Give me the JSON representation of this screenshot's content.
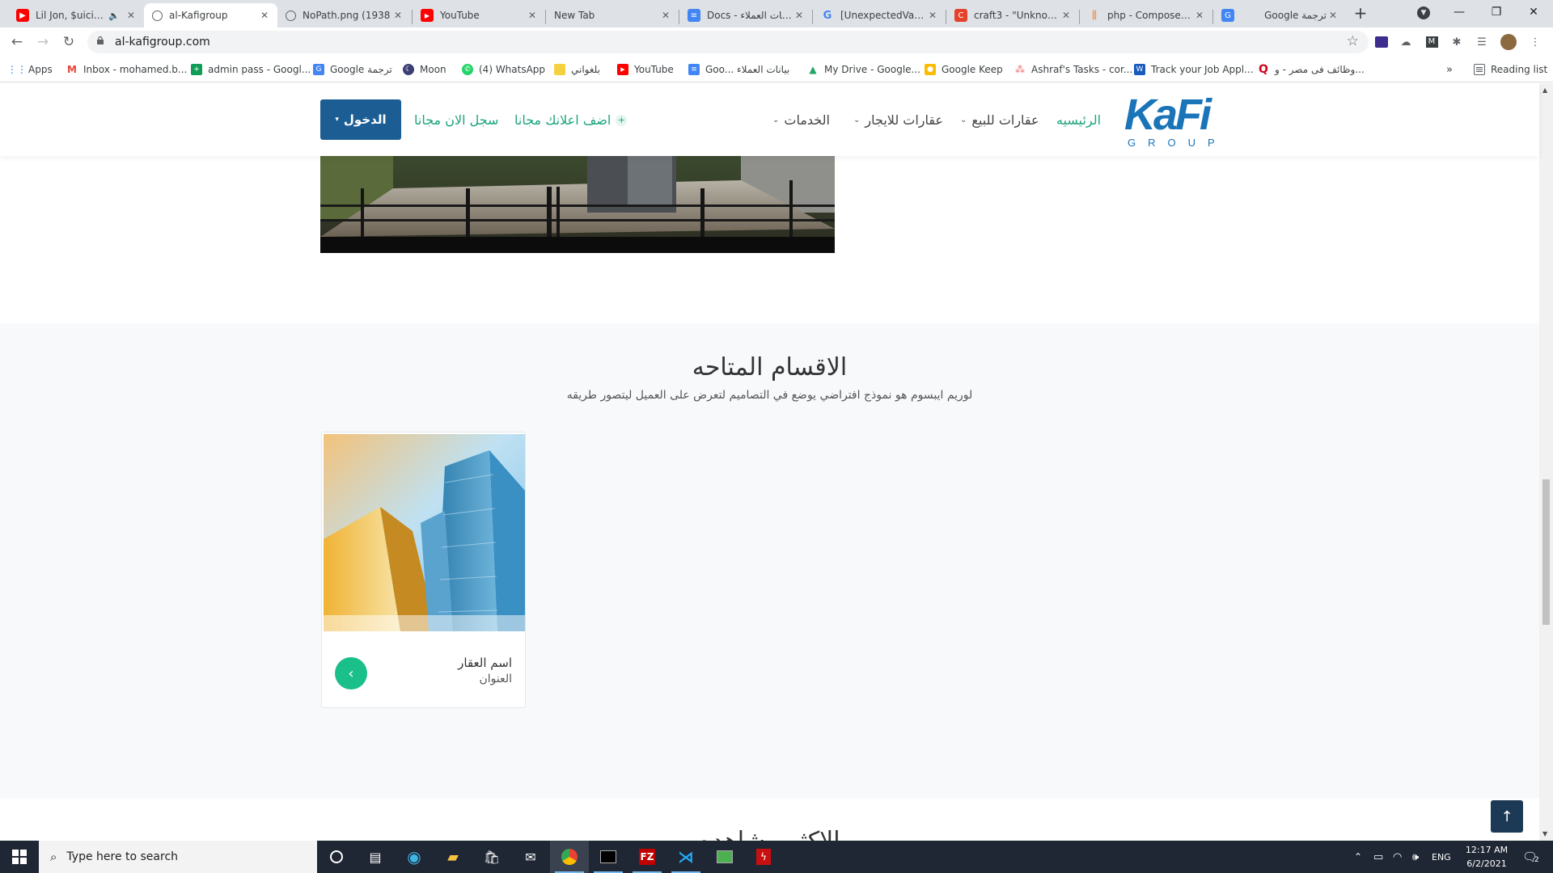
{
  "browser": {
    "tabs": [
      {
        "title": "Lil Jon, $uicide",
        "favicon": "youtube-icon",
        "color": "#ff0000",
        "muted": true
      },
      {
        "title": "al-Kafigroup",
        "favicon": "globe-icon",
        "color": "#5f6368",
        "active": true
      },
      {
        "title": "NoPath.png (1938",
        "favicon": "globe-icon",
        "color": "#5f6368"
      },
      {
        "title": "YouTube",
        "favicon": "youtube-icon",
        "color": "#ff0000"
      },
      {
        "title": "New Tab",
        "favicon": "none",
        "color": ""
      },
      {
        "title": "Docs - بيانات العملاء",
        "favicon": "docs-icon",
        "color": "#4285f4"
      },
      {
        "title": "[UnexpectedValue",
        "favicon": "google-icon",
        "color": "#4285f4"
      },
      {
        "title": "craft3 - \"Unknown",
        "favicon": "craft-icon",
        "color": "#e5422b"
      },
      {
        "title": "php - Composer c",
        "favicon": "stackoverflow-icon",
        "color": "#f48024"
      },
      {
        "title": "Google ترجمة",
        "favicon": "translate-icon",
        "color": "#4285f4"
      }
    ],
    "url": "al-kafigroup.com",
    "bookmarks": [
      {
        "label": "Apps",
        "icon": "apps-grid-icon",
        "color": "#ea4335"
      },
      {
        "label": "Inbox - mohamed.b...",
        "icon": "gmail-icon",
        "color": "#ea4335"
      },
      {
        "label": "admin pass - Googl...",
        "icon": "sheets-plus-icon",
        "color": "#0f9d58"
      },
      {
        "label": "Google ترجمة",
        "icon": "translate-icon",
        "color": "#4285f4"
      },
      {
        "label": "Moon",
        "icon": "moon-icon",
        "color": "#3b3f73"
      },
      {
        "label": "(4) WhatsApp",
        "icon": "whatsapp-icon",
        "color": "#25d366"
      },
      {
        "label": "بلغواني",
        "icon": "note-icon",
        "color": "#f6d13f"
      },
      {
        "label": "YouTube",
        "icon": "youtube-icon",
        "color": "#ff0000"
      },
      {
        "label": "Goo... بيانات العملاء",
        "icon": "docs-icon",
        "color": "#4285f4"
      },
      {
        "label": "My Drive - Google...",
        "icon": "drive-icon",
        "color": "#1fa463"
      },
      {
        "label": "Google Keep",
        "icon": "keep-icon",
        "color": "#fbbc04"
      },
      {
        "label": "Ashraf's Tasks - cor...",
        "icon": "asana-icon",
        "color": "#f06a6a"
      },
      {
        "label": "Track your Job Appl...",
        "icon": "word-icon",
        "color": "#185abd"
      },
      {
        "label": "وظائف فى مصر - و...",
        "icon": "search-q-icon",
        "color": "#d0021b"
      }
    ],
    "reading_list": "Reading list"
  },
  "site": {
    "nav": {
      "home": "الرئيسيه",
      "for_sale": "عقارات للبيع",
      "for_rent": "عقارات للايجار",
      "services": "الخدمات",
      "add_ad": "اضف اعلانك مجانا",
      "register": "سجل الان مجانا",
      "login": "الدخول"
    },
    "logo": {
      "main": "KaFi",
      "sub": "GROUP"
    },
    "sections": {
      "title": "الاقسام المتاحه",
      "subtitle": "لوريم ايبسوم هو نموذج افتراضي يوضع في التصاميم لتعرض على العميل ليتصور طريقه"
    },
    "card": {
      "title": "اسم العقار",
      "subtitle": "العنوان"
    },
    "next_heading": "الاكثر مشاهده"
  },
  "taskbar": {
    "search_placeholder": "Type here to search",
    "time": "12:17 AM",
    "date": "6/2/2021",
    "lang": "ENG",
    "notifications": "2"
  }
}
